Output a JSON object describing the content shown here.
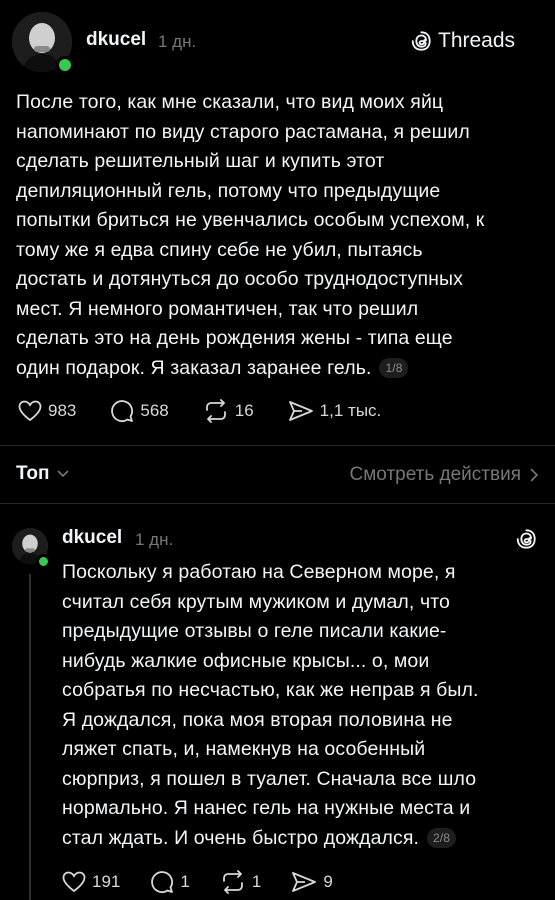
{
  "post1": {
    "username": "dkucel",
    "time": "1 дн.",
    "brand": "Threads",
    "lines": [
      "После того, как мне сказали, что вид моих яйц",
      "напоминают по виду старого растамана, я решил",
      "сделать решительный шаг и купить этот",
      "депиляционный гель, потому что предыдущие",
      "попытки бриться не увенчались особым успехом, к",
      "тому же я едва спину себе не убил, пытаясь",
      "достать и дотянуться до особо труднодоступных",
      "мест. Я немного романтичен, так что решил",
      "сделать это на день рождения жены - типа еще",
      "один подарок. Я заказал заранее гель."
    ],
    "pager": "1/8",
    "likes": "983",
    "replies": "568",
    "reposts": "16",
    "shares": "1,1 тыс."
  },
  "sort": {
    "label": "Топ",
    "view_activity": "Смотреть действия"
  },
  "post2": {
    "username": "dkucel",
    "time": "1 дн.",
    "lines": [
      "Поскольку я работаю на Северном море, я",
      "считал себя крутым мужиком и думал, что",
      "предыдущие отзывы о геле писали какие-",
      "нибудь жалкие офисные крысы... о, мои",
      "собратья по несчастью, как же неправ я был.",
      "Я дождался, пока моя вторая половина не",
      "ляжет спать, и, намекнув на особенный",
      "сюрприз, я пошел в туалет. Сначала все шло",
      "нормально. Я нанес гель на нужные места и",
      "стал ждать. И очень быстро дождался."
    ],
    "pager": "2/8",
    "likes": "191",
    "replies": "1",
    "reposts": "1",
    "shares": "9"
  },
  "colors": {
    "background": "#000000",
    "text": "#f3f5f7",
    "muted": "#777777",
    "online": "#37c84f"
  }
}
